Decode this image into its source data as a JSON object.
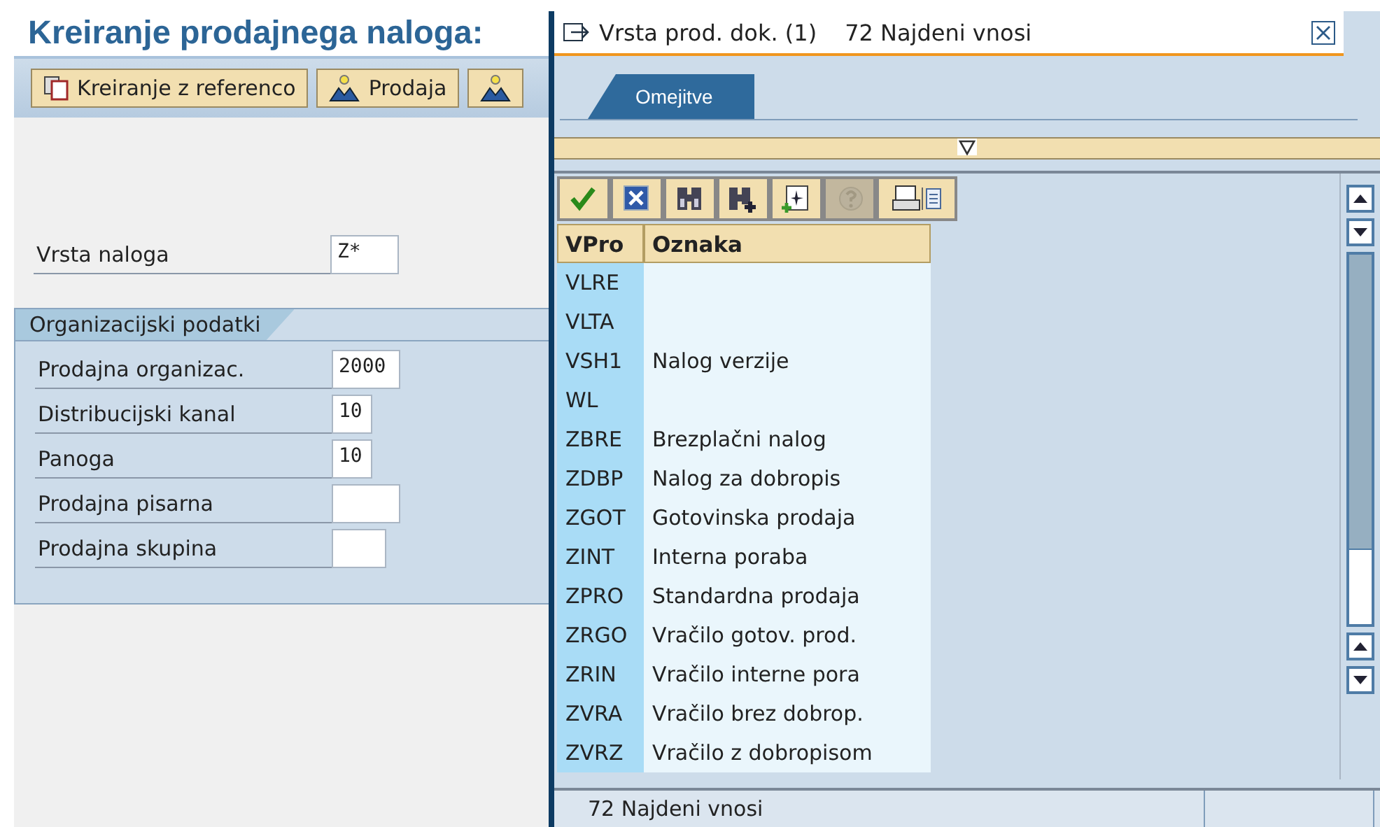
{
  "screen": {
    "title": "Kreiranje prodajnega naloga:",
    "toolbar": [
      {
        "kind": "text",
        "label": "Kreiranje z referenco"
      },
      {
        "kind": "text",
        "label": "Prodaja"
      },
      {
        "kind": "icon"
      }
    ],
    "fields": [
      {
        "label": "Vrsta naloga",
        "value": "Z*"
      }
    ],
    "group": {
      "title": "Organizacijski podatki",
      "fields": [
        {
          "label": "Prodajna organizac.",
          "value": "2000"
        },
        {
          "label": "Distribucijski kanal",
          "value": "10"
        },
        {
          "label": "Panoga",
          "value": "10"
        },
        {
          "label": "Prodajna pisarna"
        },
        {
          "label": "Prodajna skupina"
        }
      ]
    }
  },
  "dialog": {
    "title": "Vrsta prod. dok. (1)",
    "count": "72 Najdeni vnosi",
    "tabs": [
      {
        "label": "Omejitve",
        "selected": true
      }
    ],
    "toolbar": [
      {
        "kind": "confirm",
        "disabled": false
      },
      {
        "kind": "cancel",
        "disabled": false
      },
      {
        "kind": "find",
        "disabled": false
      },
      {
        "kind": "find-next",
        "disabled": false
      },
      {
        "kind": "new",
        "disabled": false
      },
      {
        "kind": "help",
        "disabled": true
      },
      {
        "kind": "print",
        "disabled": false
      }
    ],
    "table": {
      "columns": [
        "VPro",
        "Oznaka"
      ],
      "rows": [
        [
          "VLRE",
          ""
        ],
        [
          "VLTA",
          ""
        ],
        [
          "VSH1",
          "Nalog verzije"
        ],
        [
          "WL",
          ""
        ],
        [
          "ZBRE",
          "Brezplačni nalog"
        ],
        [
          "ZDBP",
          "Nalog za dobropis"
        ],
        [
          "ZGOT",
          "Gotovinska prodaja"
        ],
        [
          "ZINT",
          "Interna poraba"
        ],
        [
          "ZPRO",
          "Standardna prodaja"
        ],
        [
          "ZRGO",
          "Vračilo gotov. prod."
        ],
        [
          "ZRIN",
          "Vračilo interne pora"
        ],
        [
          "ZVRA",
          "Vračilo brez dobrop."
        ],
        [
          "ZVRZ",
          "Vračilo z dobropisom"
        ]
      ]
    },
    "status_bar": "72 Najdeni vnosi"
  }
}
